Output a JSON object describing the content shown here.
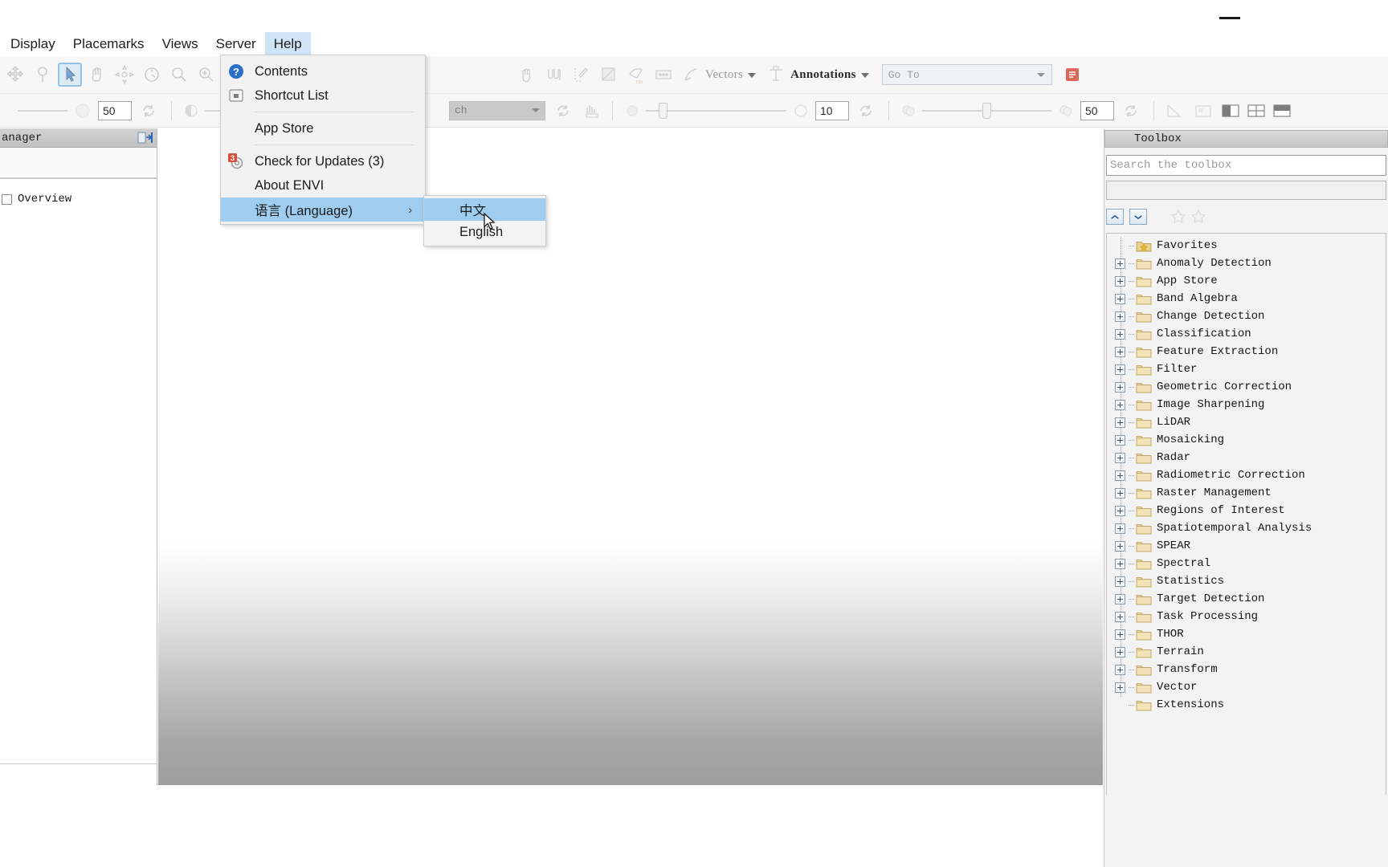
{
  "window": {
    "minimize_label": "minimize"
  },
  "menubar": {
    "items": [
      {
        "label": "Display",
        "name": "menu-display"
      },
      {
        "label": "Placemarks",
        "name": "menu-placemarks"
      },
      {
        "label": "Views",
        "name": "menu-views"
      },
      {
        "label": "Server",
        "name": "menu-server"
      },
      {
        "label": "Help",
        "name": "menu-help",
        "open": true
      }
    ]
  },
  "help_menu": {
    "items": [
      {
        "label": "Contents",
        "icon": "help-question-icon"
      },
      {
        "label": "Shortcut List",
        "icon": "shortcut-list-icon"
      },
      {
        "label": "App Store",
        "icon": "none"
      },
      {
        "label": "Check for Updates (3)",
        "icon": "updates-icon"
      },
      {
        "label": "About ENVI",
        "icon": "none"
      },
      {
        "label": "语言 (Language)",
        "icon": "none",
        "submenu_arrow": "›",
        "highlighted": true
      }
    ]
  },
  "language_submenu": {
    "items": [
      {
        "label": "中文",
        "highlighted": true
      },
      {
        "label": "English",
        "highlighted": false
      }
    ]
  },
  "toolbar_row1": {
    "vectors_label": "Vectors",
    "annotations_label": "Annotations",
    "goto": {
      "value": "",
      "placeholder": "Go To"
    }
  },
  "toolbar_row2": {
    "field_1": "50",
    "field_2": "10",
    "field_3": "50",
    "combo_value": "ch"
  },
  "left_panel": {
    "title": "anager",
    "nodes": [
      {
        "label": "Overview",
        "checked": false
      }
    ]
  },
  "toolbox": {
    "title": "Toolbox",
    "search": {
      "value": "",
      "placeholder": "Search the toolbox"
    },
    "items": [
      {
        "label": "Favorites",
        "expandable": false,
        "favorite": true
      },
      {
        "label": "Anomaly Detection",
        "expandable": true
      },
      {
        "label": "App Store",
        "expandable": true
      },
      {
        "label": "Band Algebra",
        "expandable": true
      },
      {
        "label": "Change Detection",
        "expandable": true
      },
      {
        "label": "Classification",
        "expandable": true
      },
      {
        "label": "Feature Extraction",
        "expandable": true
      },
      {
        "label": "Filter",
        "expandable": true
      },
      {
        "label": "Geometric Correction",
        "expandable": true
      },
      {
        "label": "Image Sharpening",
        "expandable": true
      },
      {
        "label": "LiDAR",
        "expandable": true
      },
      {
        "label": "Mosaicking",
        "expandable": true
      },
      {
        "label": "Radar",
        "expandable": true
      },
      {
        "label": "Radiometric Correction",
        "expandable": true
      },
      {
        "label": "Raster Management",
        "expandable": true
      },
      {
        "label": "Regions of Interest",
        "expandable": true
      },
      {
        "label": "Spatiotemporal Analysis",
        "expandable": true
      },
      {
        "label": "SPEAR",
        "expandable": true
      },
      {
        "label": "Spectral",
        "expandable": true
      },
      {
        "label": "Statistics",
        "expandable": true
      },
      {
        "label": "Target Detection",
        "expandable": true
      },
      {
        "label": "Task Processing",
        "expandable": true
      },
      {
        "label": "THOR",
        "expandable": true
      },
      {
        "label": "Terrain",
        "expandable": true
      },
      {
        "label": "Transform",
        "expandable": true
      },
      {
        "label": "Vector",
        "expandable": true
      },
      {
        "label": "Extensions",
        "expandable": false
      }
    ]
  },
  "colors": {
    "menu_open_bg": "#cfe5f7",
    "highlight_blue": "#9ecdf0",
    "folder_yellow": "#e9d08a",
    "panel_bg": "#f3f3f3"
  }
}
